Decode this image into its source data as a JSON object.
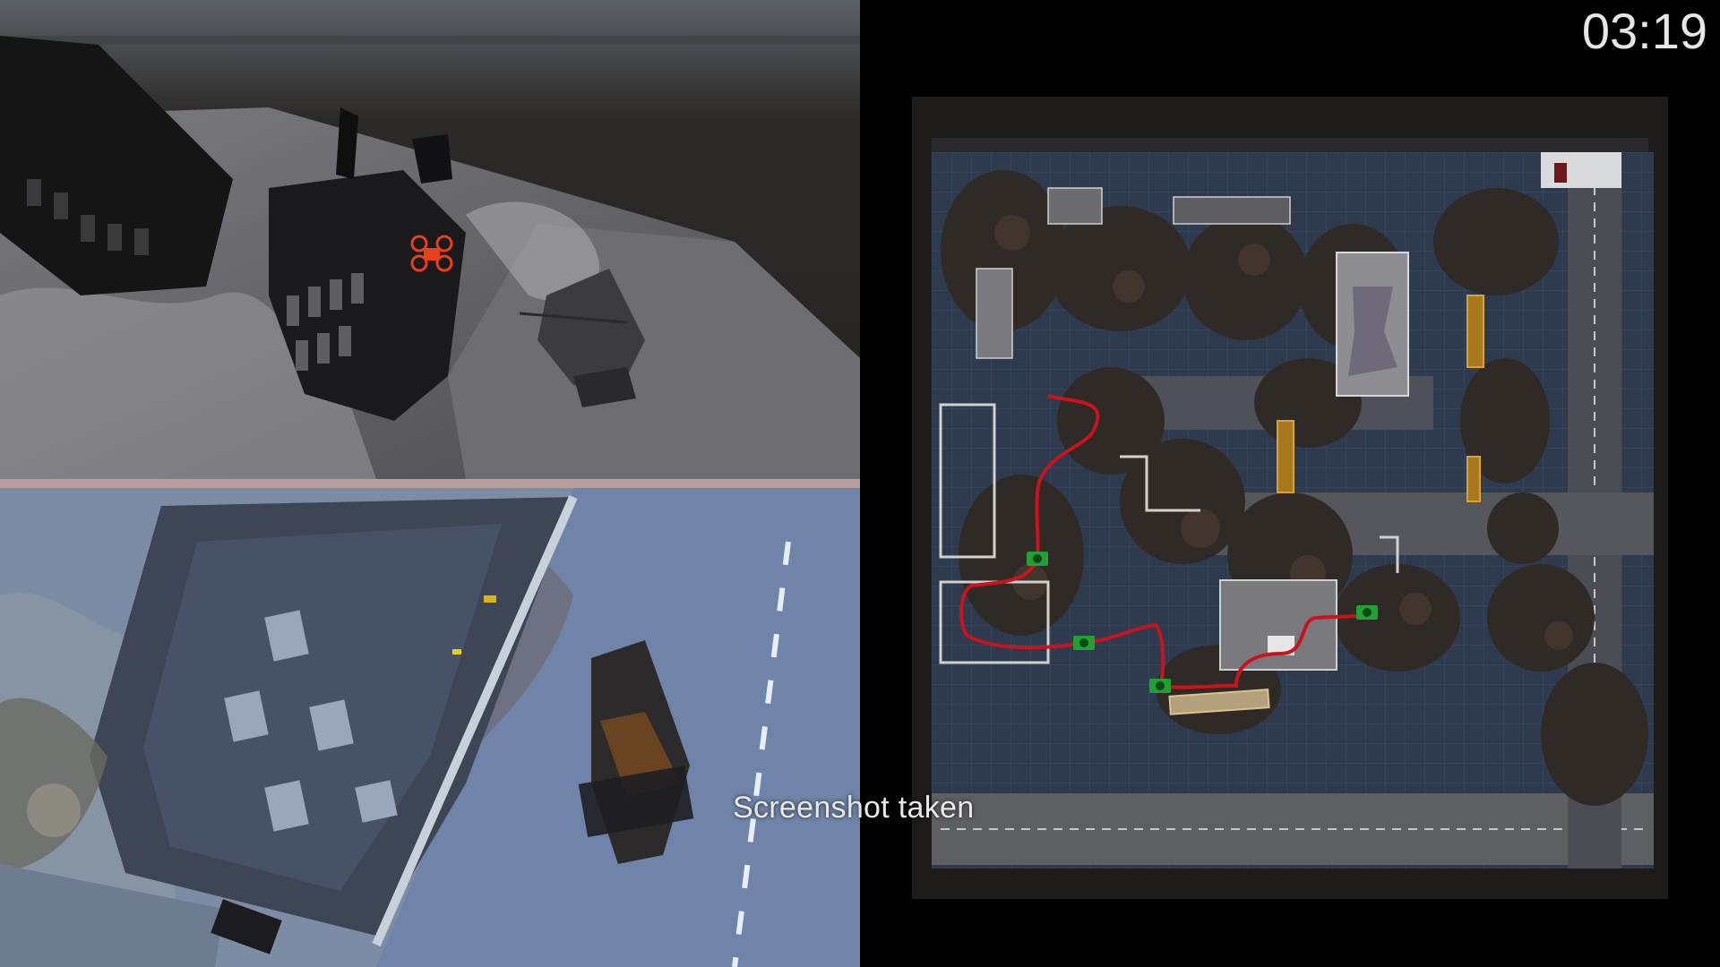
{
  "hud": {
    "timer": "03:19",
    "toast": "Screenshot taken"
  },
  "views": {
    "top": {
      "name": "drone-camera-view",
      "drone_color": "#e8401a"
    },
    "bottom": {
      "name": "overhead-camera-view"
    }
  },
  "map": {
    "path_color": "#c8141e",
    "camera_marker_color": "#22a035",
    "camera_marker_icon": "camera-icon"
  }
}
